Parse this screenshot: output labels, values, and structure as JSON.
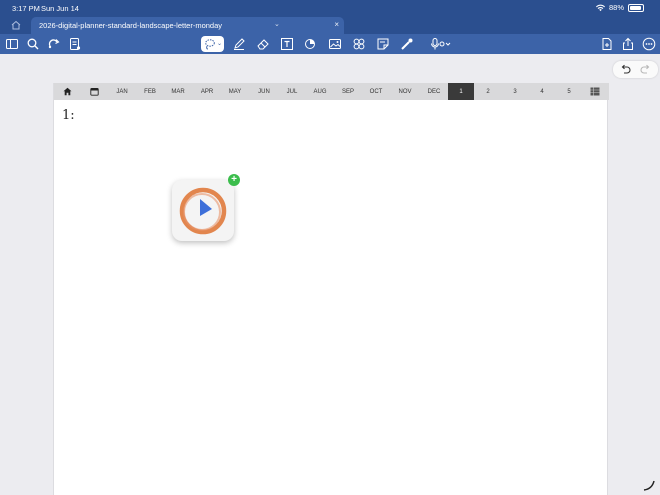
{
  "status": {
    "time": "3:17 PM",
    "date": "Sun Jun 14",
    "battery": "88%",
    "battery_level": 0.88
  },
  "tab": {
    "title": "2026-digital-planner-standard-landscape-letter-monday"
  },
  "toolbar": {
    "left_tools": [
      "sidebar-icon",
      "search-icon",
      "share-add-icon",
      "doc-list-icon"
    ],
    "center_tools": [
      "lasso-icon",
      "pen-icon",
      "eraser-icon",
      "text-box-icon",
      "shapes-icon",
      "image-icon",
      "sticker-icon",
      "sticky-note-icon",
      "laser-pointer-icon",
      "microphone-icon"
    ],
    "right_tools": [
      "add-page-icon",
      "export-icon",
      "more-icon"
    ]
  },
  "planner": {
    "months": [
      "JAN",
      "FEB",
      "MAR",
      "APR",
      "MAY",
      "JUN",
      "JUL",
      "AUG",
      "SEP",
      "OCT",
      "NOV",
      "DEC"
    ],
    "tabs": [
      "1",
      "2",
      "3",
      "4",
      "5"
    ],
    "active_tab": "1",
    "heading": "1:"
  },
  "colors": {
    "toolbar": "#3c63a8",
    "statusbar": "#2b4f8f",
    "active_tab": "#3a3a3a",
    "badge": "#3bbd4c",
    "icon_ring": "#e07a3c",
    "icon_play": "#3d6fd9"
  }
}
